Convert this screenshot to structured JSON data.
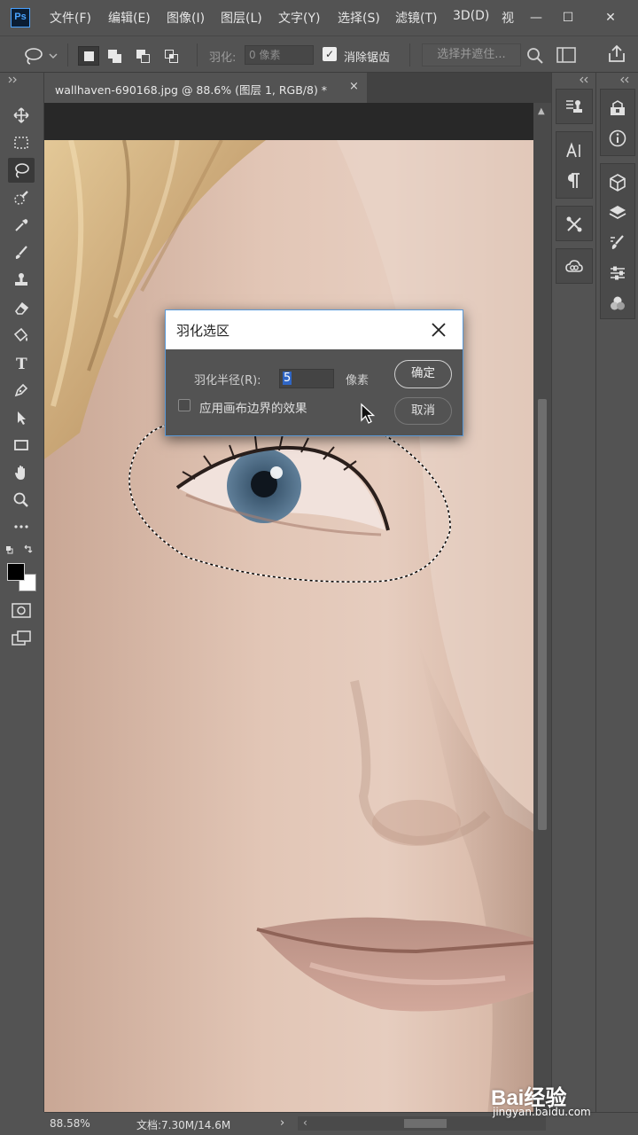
{
  "app": {
    "logo_text": "Ps"
  },
  "menu": {
    "items": [
      "文件(F)",
      "编辑(E)",
      "图像(I)",
      "图层(L)",
      "文字(Y)",
      "选择(S)",
      "滤镜(T)",
      "3D(D)",
      "视"
    ]
  },
  "window_controls": {
    "minimize": "—",
    "maximize": "☐",
    "close": "✕"
  },
  "options_bar": {
    "feather_label": "羽化:",
    "feather_value": "0 像素",
    "antialias_checked": true,
    "antialias_label": "消除锯齿",
    "select_mask_label": "选择并遮住..."
  },
  "document_tab": {
    "title": "wallhaven-690168.jpg @ 88.6% (图层 1, RGB/8) *",
    "close": "×"
  },
  "feather_dialog": {
    "title": "羽化选区",
    "radius_label": "羽化半径(R):",
    "radius_value": "5",
    "radius_unit": "像素",
    "canvas_bounds_label": "应用画布边界的效果",
    "canvas_bounds_checked": false,
    "ok_label": "确定",
    "cancel_label": "取消"
  },
  "status_bar": {
    "zoom": "88.58%",
    "doc_info": "文档:7.30M/14.6M",
    "arrow": "›",
    "scroll_left": "‹"
  },
  "watermark": {
    "brand": "Bai经验",
    "url": "jingyan.baidu.com"
  },
  "colors": {
    "ui_bg": "#535353",
    "panel_dark": "#424242",
    "accent_blue": "#5b9ad8",
    "foreground_swatch": "#000000",
    "background_swatch": "#ffffff"
  },
  "tools": [
    "move-icon",
    "marquee-icon",
    "lasso-icon",
    "quick-select-icon",
    "eyedropper-icon",
    "brush-icon",
    "stamp-icon",
    "eraser-icon",
    "bucket-icon",
    "type-icon",
    "pen-icon",
    "path-select-icon",
    "rectangle-icon",
    "hand-icon",
    "zoom-icon",
    "more-icon"
  ],
  "type_tool_glyph": "T"
}
